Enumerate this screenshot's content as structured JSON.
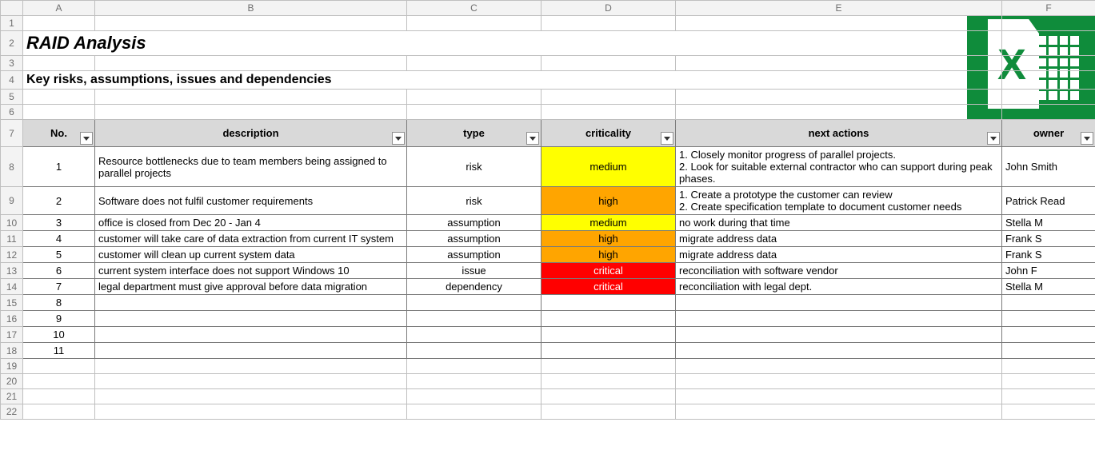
{
  "columns": [
    "A",
    "B",
    "C",
    "D",
    "E",
    "F"
  ],
  "title": "RAID Analysis",
  "subtitle": "Key risks, assumptions, issues and dependencies",
  "headers": {
    "no": "No.",
    "description": "description",
    "type": "type",
    "criticality": "criticality",
    "next_actions": "next actions",
    "owner": "owner"
  },
  "rows": [
    {
      "no": "1",
      "description": "Resource bottlenecks due to team members being assigned to parallel projects",
      "type": "risk",
      "criticality": "medium",
      "crit_class": "crit-medium",
      "next_actions": "1. Closely monitor progress of parallel projects.\n2. Look for suitable external contractor who can support during peak phases.",
      "owner": "John Smith"
    },
    {
      "no": "2",
      "description": "Software does not fulfil customer requirements",
      "type": "risk",
      "criticality": "high",
      "crit_class": "crit-high",
      "next_actions": "1. Create a prototype the customer can review\n2. Create specification template to document customer needs",
      "owner": "Patrick Read"
    },
    {
      "no": "3",
      "description": "office is closed from Dec 20 - Jan 4",
      "type": "assumption",
      "criticality": "medium",
      "crit_class": "crit-medium",
      "next_actions": "no work during that time",
      "owner": "Stella M"
    },
    {
      "no": "4",
      "description": "customer will take care of data extraction from current IT system",
      "type": "assumption",
      "criticality": "high",
      "crit_class": "crit-high",
      "next_actions": "migrate address data",
      "owner": "Frank S"
    },
    {
      "no": "5",
      "description": "customer will clean up current system data",
      "type": "assumption",
      "criticality": "high",
      "crit_class": "crit-high",
      "next_actions": "migrate address data",
      "owner": "Frank S"
    },
    {
      "no": "6",
      "description": "current system interface does not support Windows 10",
      "type": "issue",
      "criticality": "critical",
      "crit_class": "crit-critical",
      "next_actions": "reconciliation with software vendor",
      "owner": "John F"
    },
    {
      "no": "7",
      "description": "legal department must give approval before data migration",
      "type": "dependency",
      "criticality": "critical",
      "crit_class": "crit-critical",
      "next_actions": "reconciliation with legal dept.",
      "owner": "Stella M"
    },
    {
      "no": "8",
      "description": "",
      "type": "",
      "criticality": "",
      "crit_class": "",
      "next_actions": "",
      "owner": ""
    },
    {
      "no": "9",
      "description": "",
      "type": "",
      "criticality": "",
      "crit_class": "",
      "next_actions": "",
      "owner": ""
    },
    {
      "no": "10",
      "description": "",
      "type": "",
      "criticality": "",
      "crit_class": "",
      "next_actions": "",
      "owner": ""
    },
    {
      "no": "11",
      "description": "",
      "type": "",
      "criticality": "",
      "crit_class": "",
      "next_actions": "",
      "owner": ""
    }
  ],
  "blank_tail_rows": [
    "19",
    "20",
    "21",
    "22"
  ],
  "chart_data": {
    "type": "table",
    "title": "RAID Analysis — Key risks, assumptions, issues and dependencies",
    "columns": [
      "No.",
      "description",
      "type",
      "criticality",
      "next actions",
      "owner"
    ],
    "rows": [
      [
        "1",
        "Resource bottlenecks due to team members being assigned to parallel projects",
        "risk",
        "medium",
        "1. Closely monitor progress of parallel projects. 2. Look for suitable external contractor who can support during peak phases.",
        "John Smith"
      ],
      [
        "2",
        "Software does not fulfil customer requirements",
        "risk",
        "high",
        "1. Create a prototype the customer can review 2. Create specification template to document customer needs",
        "Patrick Read"
      ],
      [
        "3",
        "office is closed from Dec 20 - Jan 4",
        "assumption",
        "medium",
        "no work during that time",
        "Stella M"
      ],
      [
        "4",
        "customer will take care of data extraction from current IT system",
        "assumption",
        "high",
        "migrate address data",
        "Frank S"
      ],
      [
        "5",
        "customer will clean up current system data",
        "assumption",
        "high",
        "migrate address data",
        "Frank S"
      ],
      [
        "6",
        "current system interface does not support Windows 10",
        "issue",
        "critical",
        "reconciliation with software vendor",
        "John F"
      ],
      [
        "7",
        "legal department must give approval before data migration",
        "dependency",
        "critical",
        "reconciliation with legal dept.",
        "Stella M"
      ]
    ]
  }
}
